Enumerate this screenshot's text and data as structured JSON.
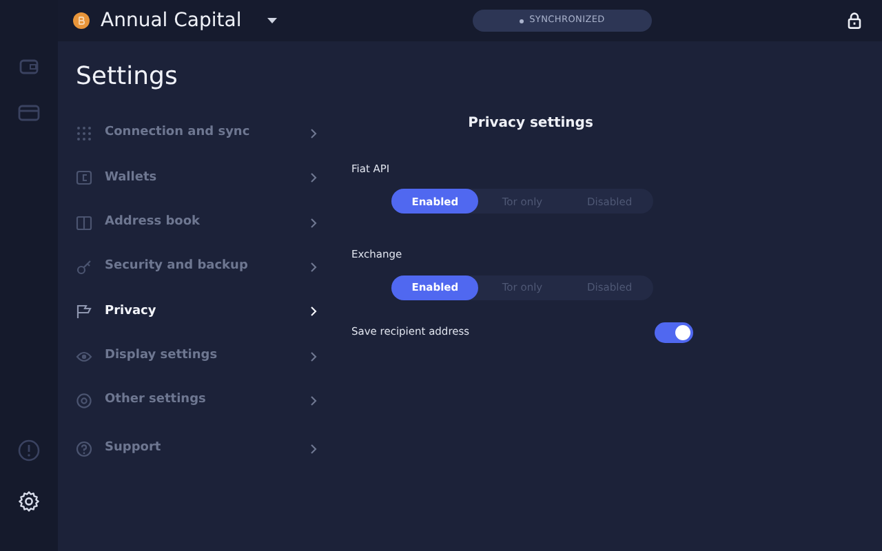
{
  "wallet": {
    "name": "Annual Capital"
  },
  "sync_status": {
    "label": "SYNCHRONIZED"
  },
  "settings": {
    "title": "Settings",
    "menu": [
      {
        "label": "Connection and sync",
        "selected": false
      },
      {
        "label": "Wallets",
        "selected": false
      },
      {
        "label": "Address book",
        "selected": false
      },
      {
        "label": "Security and backup",
        "selected": false
      },
      {
        "label": "Privacy",
        "selected": true
      },
      {
        "label": "Display settings",
        "selected": false
      },
      {
        "label": "Other settings",
        "selected": false
      },
      {
        "label": "Support",
        "selected": false
      }
    ]
  },
  "privacy": {
    "title": "Privacy settings",
    "options": [
      {
        "kind": "segmented",
        "label": "Fiat API",
        "choices": [
          {
            "label": "Enabled",
            "selected": true
          },
          {
            "label": "Tor only",
            "selected": false
          },
          {
            "label": "Disabled",
            "selected": false
          }
        ]
      },
      {
        "kind": "segmented",
        "label": "Exchange",
        "choices": [
          {
            "label": "Enabled",
            "selected": true
          },
          {
            "label": "Tor only",
            "selected": false
          },
          {
            "label": "Disabled",
            "selected": false
          }
        ]
      },
      {
        "kind": "toggle",
        "label": "Save recipient address",
        "on": true
      }
    ]
  }
}
